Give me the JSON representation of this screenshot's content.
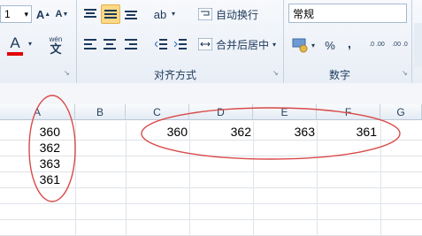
{
  "ribbon": {
    "font_size_fragment": "1",
    "grow_font": "A",
    "shrink_font": "A",
    "font_color": "A",
    "phonetic": "wén",
    "wrap_text": "自动换行",
    "merge_center": "合并后居中",
    "alignment_group": "对齐方式",
    "number_format": "常规",
    "number_group": "数字",
    "percent": "%",
    "comma": ",",
    "inc_decimal": ".0 .00",
    "dec_decimal": ".00 .0",
    "currency": "¥",
    "dropdown": "▾"
  },
  "sheet": {
    "columns": [
      "A",
      "B",
      "C",
      "D",
      "E",
      "F",
      "G"
    ],
    "column_a_values": [
      "360",
      "362",
      "363",
      "361"
    ],
    "row1_values": [
      "360",
      "362",
      "363",
      "361"
    ],
    "annotation_color": "#d94a4a"
  }
}
